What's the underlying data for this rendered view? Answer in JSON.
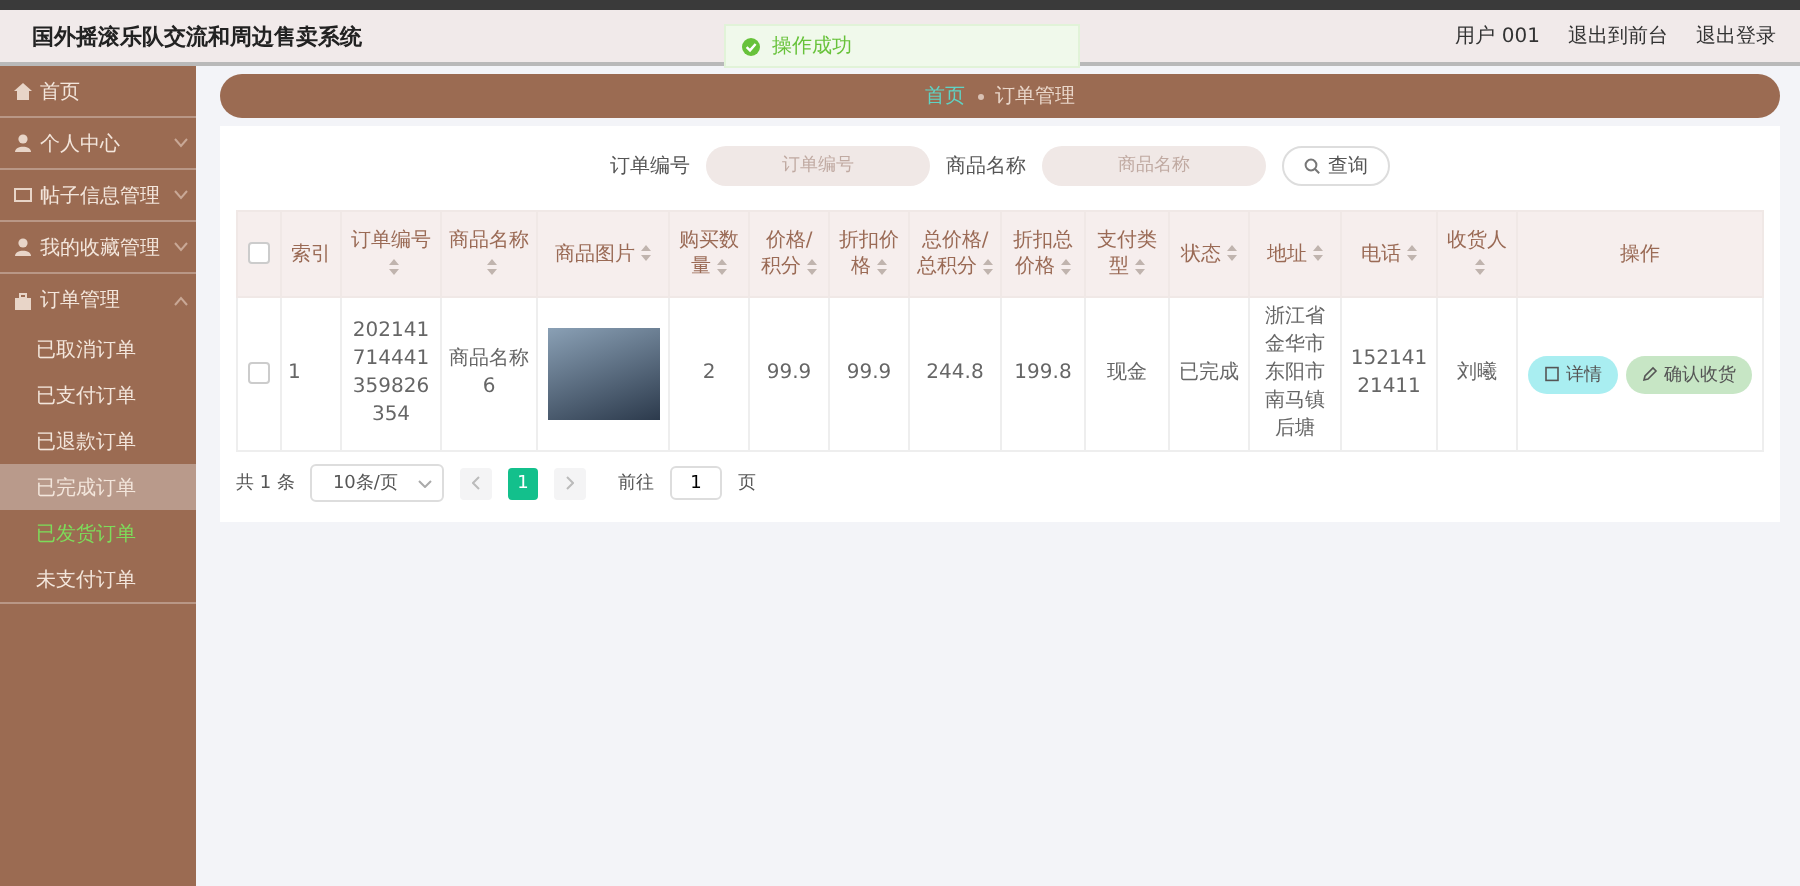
{
  "header": {
    "title": "国外摇滚乐队交流和周边售卖系统",
    "user": "用户 001",
    "links": [
      "退出到前台",
      "退出登录"
    ]
  },
  "toast": {
    "message": "操作成功"
  },
  "sidebar": {
    "items": [
      {
        "label": "首页",
        "kind": "link"
      },
      {
        "label": "个人中心",
        "kind": "submenu",
        "expanded": false
      },
      {
        "label": "帖子信息管理",
        "kind": "submenu",
        "expanded": false
      },
      {
        "label": "我的收藏管理",
        "kind": "submenu",
        "expanded": false
      },
      {
        "label": "订单管理",
        "kind": "submenu",
        "expanded": true,
        "children": [
          {
            "label": "已取消订单",
            "selected": false,
            "hovered": false
          },
          {
            "label": "已支付订单",
            "selected": false,
            "hovered": false
          },
          {
            "label": "已退款订单",
            "selected": false,
            "hovered": false
          },
          {
            "label": "已完成订单",
            "selected": false,
            "hovered": true
          },
          {
            "label": "已发货订单",
            "selected": true,
            "hovered": false
          },
          {
            "label": "未支付订单",
            "selected": false,
            "hovered": false
          }
        ]
      }
    ]
  },
  "breadcrumb": [
    "首页",
    "订单管理"
  ],
  "search": {
    "fields": [
      {
        "label": "订单编号",
        "placeholder": "订单编号"
      },
      {
        "label": "商品名称",
        "placeholder": "商品名称"
      }
    ],
    "button": "查询"
  },
  "table": {
    "select_all": {
      "checked": false
    },
    "columns": [
      {
        "label": "索引",
        "sortable": false
      },
      {
        "label": "订单编号",
        "sortable": true
      },
      {
        "label": "商品名称",
        "sortable": true
      },
      {
        "label": "商品图片",
        "sortable": true
      },
      {
        "label": "购买数量",
        "sortable": true
      },
      {
        "label": "价格/积分",
        "sortable": true
      },
      {
        "label": "折扣价格",
        "sortable": true
      },
      {
        "label": "总价格/总积分",
        "sortable": true
      },
      {
        "label": "折扣总价格",
        "sortable": true
      },
      {
        "label": "支付类型",
        "sortable": true
      },
      {
        "label": "状态",
        "sortable": true
      },
      {
        "label": "地址",
        "sortable": true
      },
      {
        "label": "电话",
        "sortable": true
      },
      {
        "label": "收货人",
        "sortable": true
      },
      {
        "label": "操作",
        "sortable": false
      }
    ],
    "rows": [
      {
        "checked": false,
        "cells": [
          {
            "kind": "text",
            "text": "1"
          },
          {
            "kind": "text",
            "text": "202141714441359826354"
          },
          {
            "kind": "text",
            "text": "商品名称6"
          },
          {
            "kind": "photo"
          },
          {
            "kind": "text",
            "text": "2"
          },
          {
            "kind": "text",
            "text": "99.9"
          },
          {
            "kind": "text",
            "text": "99.9"
          },
          {
            "kind": "text",
            "text": "244.8"
          },
          {
            "kind": "text",
            "text": "199.8"
          },
          {
            "kind": "text",
            "text": "现金"
          },
          {
            "kind": "text",
            "text": "已完成"
          },
          {
            "kind": "text",
            "text": "浙江省金华市东阳市南马镇后塘"
          },
          {
            "kind": "text",
            "text": "15214121411"
          },
          {
            "kind": "text",
            "text": "刘曦"
          }
        ],
        "actions": [
          {
            "label": "详情",
            "kind": "detail"
          },
          {
            "label": "确认收货",
            "kind": "confirm"
          }
        ]
      }
    ]
  },
  "pagination": {
    "total": "共 1 条",
    "page_size": "10条/页",
    "pages": [
      {
        "label": "1",
        "selected": true
      }
    ],
    "goto_label": "前往",
    "goto_value": "1",
    "goto_suffix": "页"
  }
}
